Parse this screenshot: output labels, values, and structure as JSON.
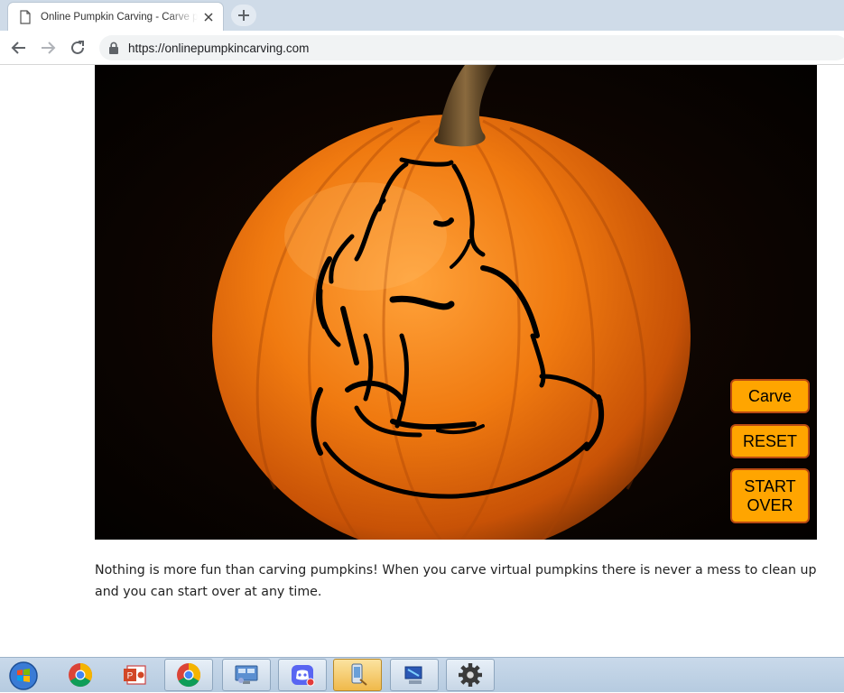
{
  "browser": {
    "tab": {
      "title": "Online Pumpkin Carving - Carve pumpkins online"
    },
    "address_bar": {
      "url": "https://onlinepumpkincarving.com"
    }
  },
  "game": {
    "buttons": {
      "carve": "Carve",
      "reset": "RESET",
      "start_over": "START\nOVER"
    },
    "colors": {
      "button_fill": "#ffa500",
      "button_border": "#b94a12",
      "pumpkin": "#f07a10",
      "background": "#050201"
    }
  },
  "page": {
    "description": "Nothing is more fun than carving pumpkins! When you carve virtual pumpkins there is never a mess to clean up and you can start over at any time."
  },
  "taskbar": {
    "items": [
      {
        "name": "start-orb-icon"
      },
      {
        "name": "chrome-icon"
      },
      {
        "name": "powerpoint-icon"
      },
      {
        "name": "chrome-icon"
      },
      {
        "name": "remote-desktop-icon"
      },
      {
        "name": "discord-icon"
      },
      {
        "name": "phone-link-icon"
      },
      {
        "name": "network-icon"
      },
      {
        "name": "settings-gear-icon"
      }
    ]
  }
}
